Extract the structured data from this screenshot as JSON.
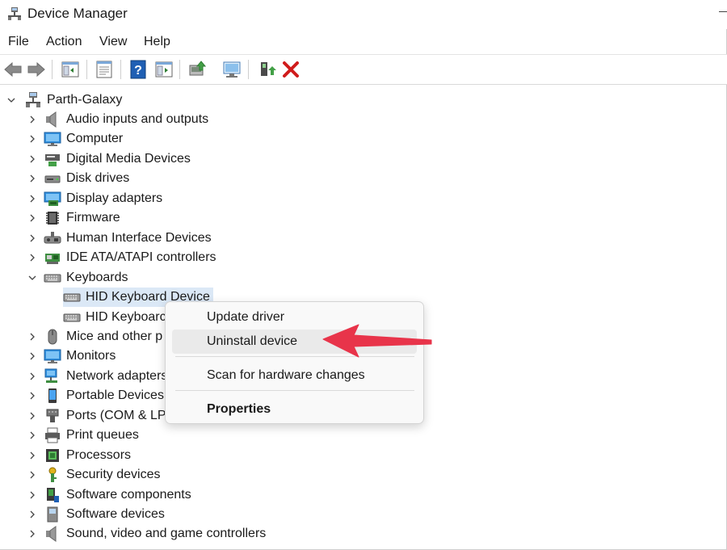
{
  "window": {
    "title": "Device Manager"
  },
  "menu": [
    "File",
    "Action",
    "View",
    "Help"
  ],
  "toolbar": {
    "buttons": [
      "back-arrow",
      "forward-arrow",
      "show-hide-console-tree",
      "properties",
      "help",
      "run",
      "update-driver",
      "scan-hardware",
      "enable-device",
      "uninstall-device"
    ]
  },
  "tree": {
    "root": "Parth-Galaxy",
    "categories": [
      {
        "label": "Audio inputs and outputs",
        "icon": "speaker-icon",
        "expanded": false
      },
      {
        "label": "Computer",
        "icon": "monitor-icon",
        "expanded": false
      },
      {
        "label": "Digital Media Devices",
        "icon": "media-device-icon",
        "expanded": false
      },
      {
        "label": "Disk drives",
        "icon": "disk-drive-icon",
        "expanded": false
      },
      {
        "label": "Display adapters",
        "icon": "display-adapter-icon",
        "expanded": false
      },
      {
        "label": "Firmware",
        "icon": "chip-icon",
        "expanded": false
      },
      {
        "label": "Human Interface Devices",
        "icon": "hid-icon",
        "expanded": false
      },
      {
        "label": "IDE ATA/ATAPI controllers",
        "icon": "ide-controller-icon",
        "expanded": false
      },
      {
        "label": "Keyboards",
        "icon": "keyboard-icon",
        "expanded": true
      }
    ],
    "keyboards": [
      "HID Keyboard Device",
      "HID Keyboard Device"
    ],
    "keyboards_visible": [
      "HID Keyboard Device",
      "HID Keyboarc"
    ],
    "after": [
      {
        "label": "Mice and other p",
        "icon": "mouse-icon"
      },
      {
        "label": "Monitors",
        "icon": "monitor-icon"
      },
      {
        "label": "Network adapters",
        "icon": "network-icon"
      },
      {
        "label": "Portable Devices",
        "icon": "portable-device-icon"
      },
      {
        "label": "Ports (COM & LPT",
        "icon": "port-icon"
      },
      {
        "label": "Print queues",
        "icon": "printer-icon"
      },
      {
        "label": "Processors",
        "icon": "processor-icon"
      },
      {
        "label": "Security devices",
        "icon": "security-key-icon"
      },
      {
        "label": "Software components",
        "icon": "software-component-icon"
      },
      {
        "label": "Software devices",
        "icon": "software-device-icon"
      },
      {
        "label": "Sound, video and game controllers",
        "icon": "speaker-icon"
      }
    ]
  },
  "context_menu": {
    "items": [
      "Update driver",
      "Uninstall device",
      "Scan for hardware changes",
      "Properties"
    ],
    "highlighted": "Uninstall device"
  },
  "colors": {
    "selection": "#dbe8f6",
    "arrow": "#e8344a",
    "uninstall_x": "#d01c1c"
  }
}
